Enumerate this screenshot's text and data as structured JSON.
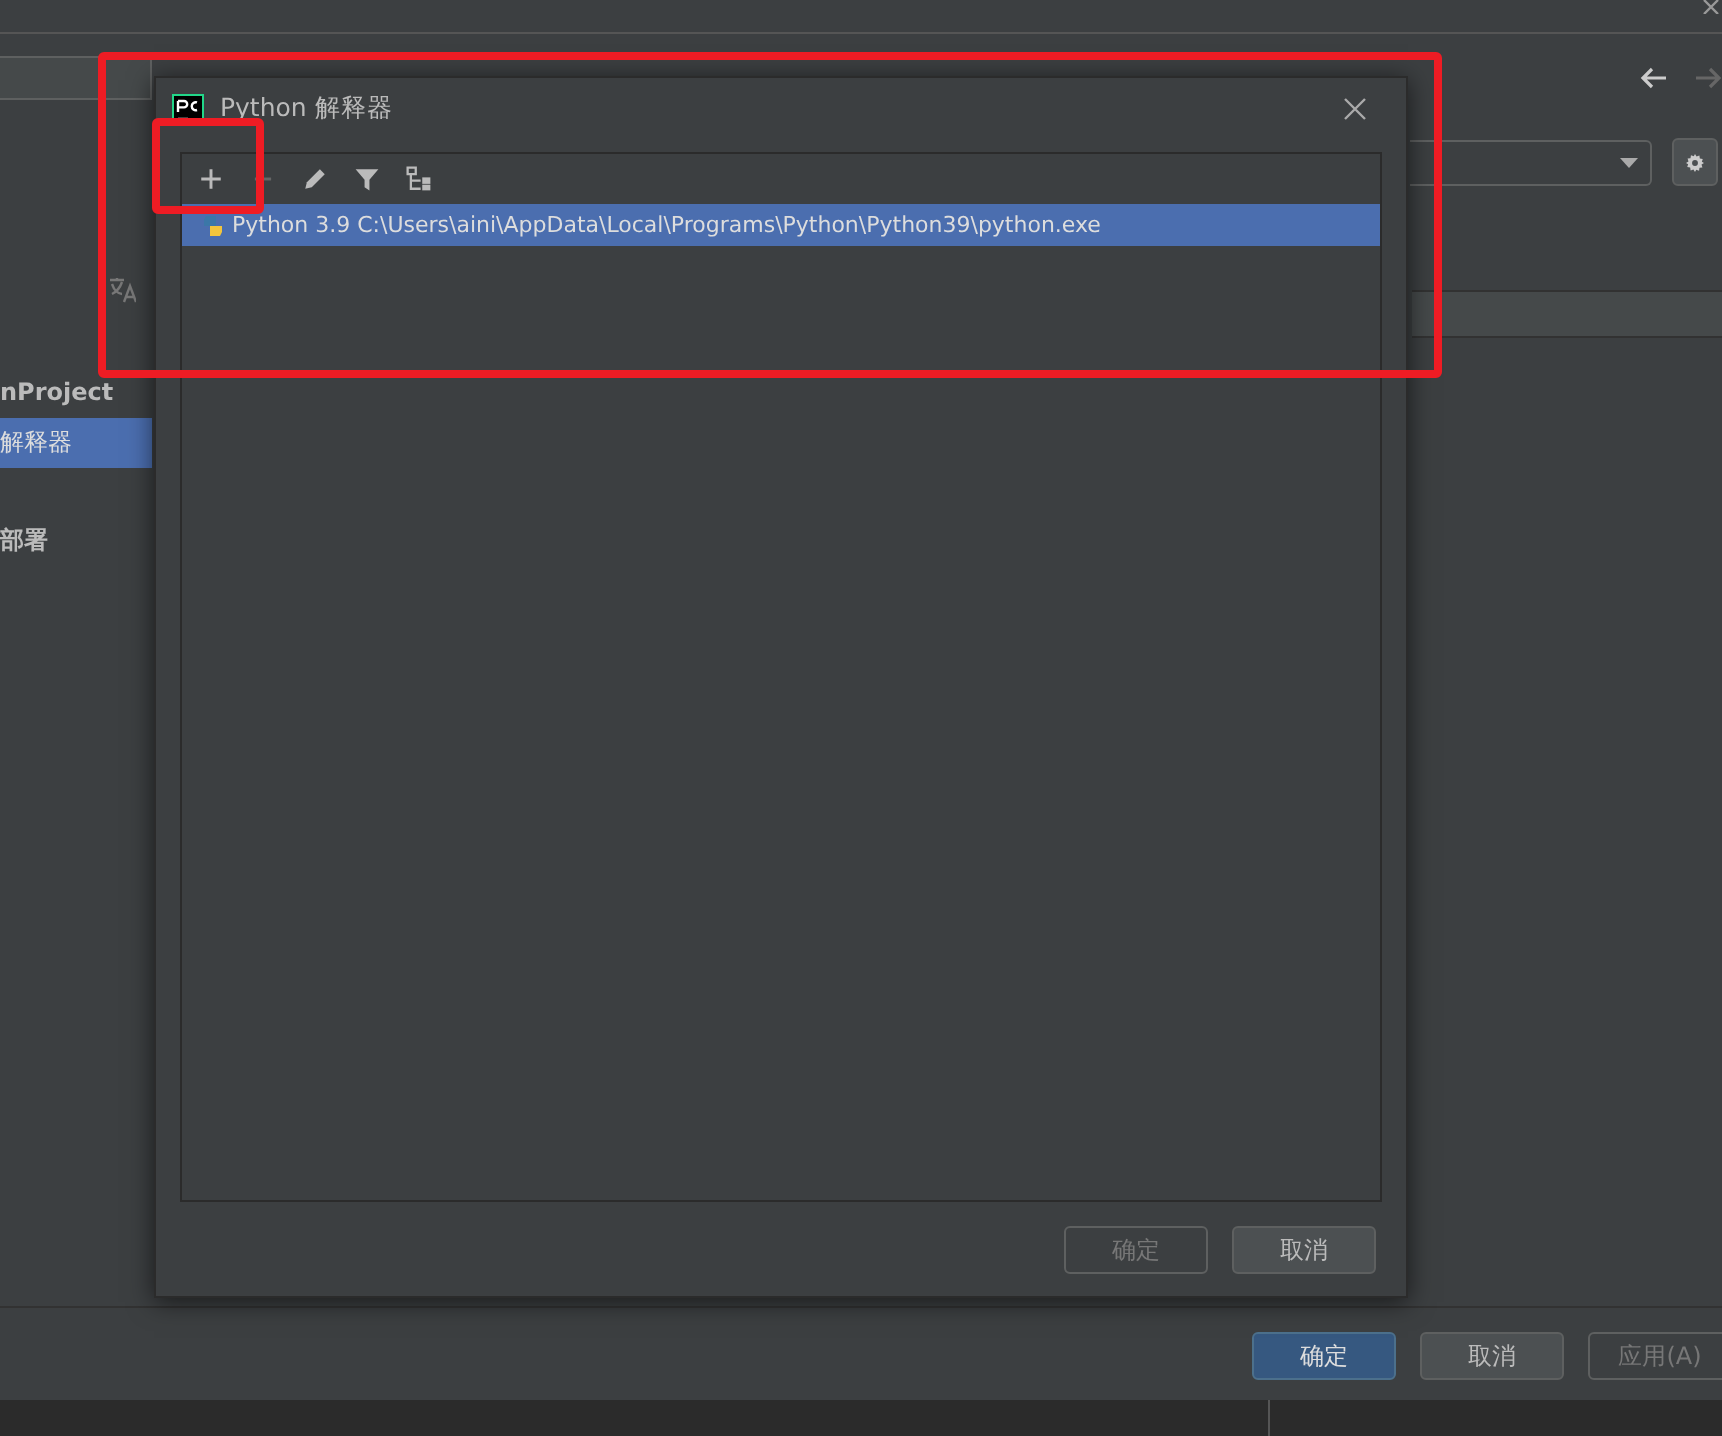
{
  "settings_window": {
    "sidebar": {
      "items": [
        {
          "label": "nProject",
          "kind": "header",
          "selected": false
        },
        {
          "label": "解释器",
          "kind": "item",
          "selected": true
        },
        {
          "label": "部署",
          "kind": "header",
          "selected": false
        }
      ]
    },
    "buttons": [
      {
        "label": "确定",
        "kind": "primary",
        "disabled": false
      },
      {
        "label": "取消",
        "kind": "default",
        "disabled": false
      },
      {
        "label": "应用(A)",
        "kind": "default",
        "disabled": true
      }
    ]
  },
  "dialog": {
    "title": "Python 解释器",
    "toolbar": [
      {
        "kind": "add",
        "highlighted": true,
        "disabled": false
      },
      {
        "kind": "remove",
        "highlighted": false,
        "disabled": true
      },
      {
        "kind": "edit",
        "highlighted": false,
        "disabled": false
      },
      {
        "kind": "filter",
        "highlighted": false,
        "disabled": false
      },
      {
        "kind": "tree",
        "highlighted": false,
        "disabled": false
      }
    ],
    "interpreters": [
      {
        "label": "Python 3.9 C:\\Users\\aini\\AppData\\Local\\Programs\\Python\\Python39\\python.exe",
        "selected": true
      }
    ],
    "buttons": [
      {
        "label": "确定",
        "disabled": true
      },
      {
        "label": "取消",
        "disabled": false
      }
    ],
    "highlighted": true
  }
}
